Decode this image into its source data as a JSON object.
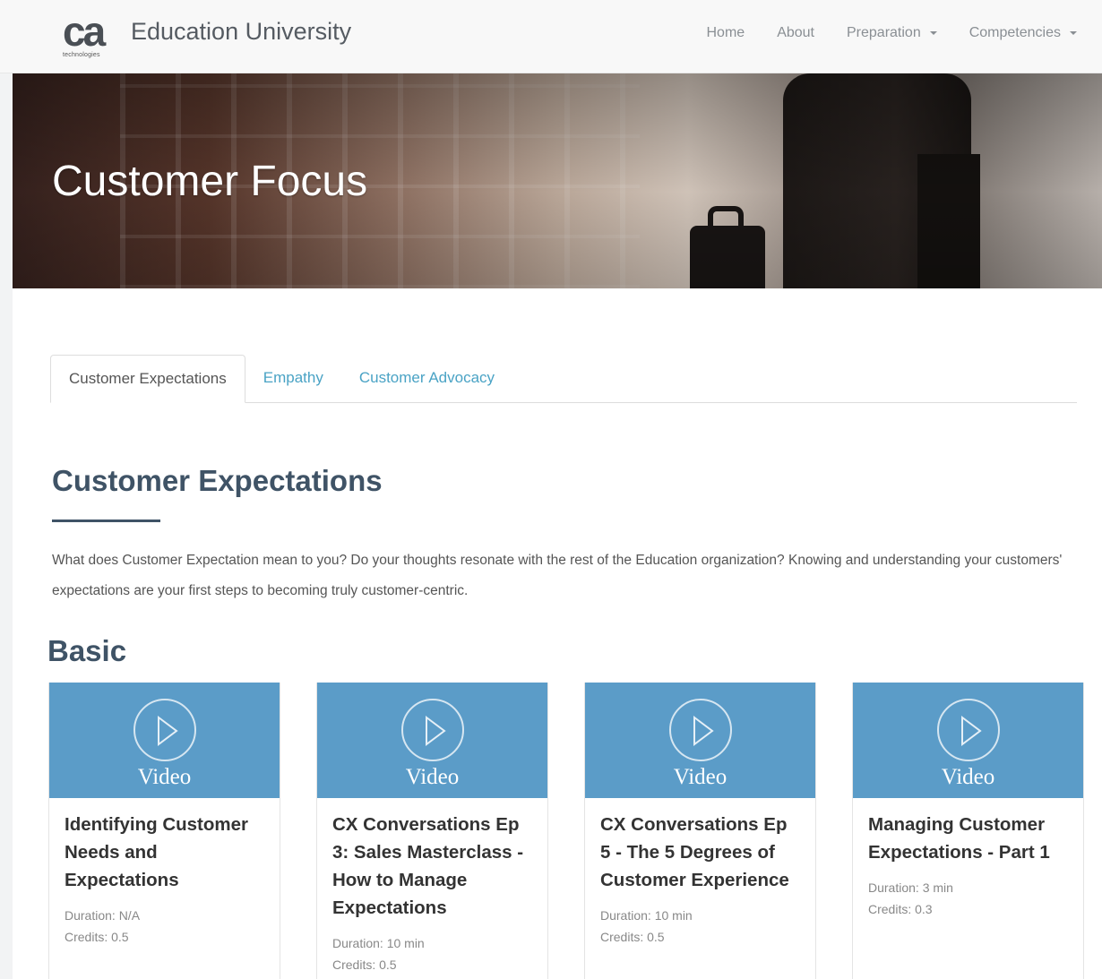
{
  "header": {
    "logo_text": "ca",
    "logo_sub": "technologies",
    "brand": "Education University",
    "nav": [
      {
        "label": "Home"
      },
      {
        "label": "About"
      },
      {
        "label": "Preparation"
      },
      {
        "label": "Competencies"
      }
    ]
  },
  "hero": {
    "title": "Customer Focus"
  },
  "tabs": [
    {
      "label": "Customer Expectations",
      "active": true
    },
    {
      "label": "Empathy",
      "active": false
    },
    {
      "label": "Customer Advocacy",
      "active": false
    }
  ],
  "section": {
    "title": "Customer Expectations",
    "description": "What does Customer Expectation mean to you? Do your thoughts resonate with the rest of the Education organization? Knowing and understanding your customers' expectations are your first steps to becoming truly customer-centric."
  },
  "level": "Basic",
  "cards": [
    {
      "media": "Video",
      "icon": "play-circle-icon",
      "title": "Identifying Customer Needs and Expectations",
      "duration": "Duration: N/A",
      "credits": "Credits: 0.5"
    },
    {
      "media": "Video",
      "icon": "play-circle-icon",
      "title": "CX Conversations Ep 3: Sales Masterclass - How to Manage Expectations",
      "duration": "Duration: 10 min",
      "credits": "Credits: 0.5"
    },
    {
      "media": "Video",
      "icon": "play-circle-icon",
      "title": "CX Conversations Ep 5 - The 5 Degrees of Customer Experience",
      "duration": "Duration: 10 min",
      "credits": "Credits: 0.5"
    },
    {
      "media": "Video",
      "icon": "play-circle-icon",
      "title": "Managing Customer Expectations - Part 1",
      "duration": "Duration: 3 min",
      "credits": "Credits: 0.3"
    }
  ],
  "colors": {
    "accent": "#5b9cc8",
    "heading": "#3f5366",
    "link": "#4aa3c5"
  }
}
